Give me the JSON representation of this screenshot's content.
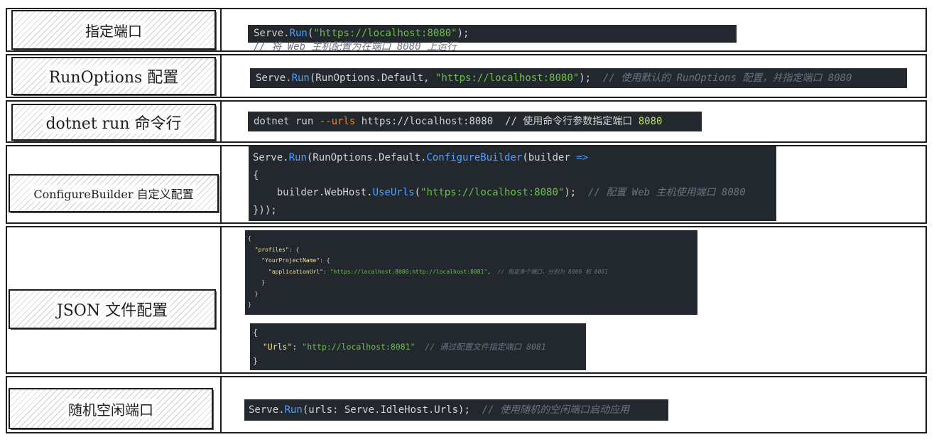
{
  "rows": [
    {
      "label": "指定端口",
      "code": [
        [
          [
            "Serve.",
            "plain"
          ],
          [
            "Run",
            "run"
          ],
          [
            "(",
            "plain"
          ],
          [
            "\"https://localhost:8080\"",
            "str"
          ],
          ");  ",
          "plain"
        ],
        [
          "// 将 Web 主机配置为在端口 8080 上运行",
          "cmt"
        ]
      ]
    },
    {
      "label": "RunOptions 配置",
      "code": [
        [
          [
            "Serve.",
            "plain"
          ],
          [
            "Run",
            "run"
          ],
          [
            "(RunOptions.Default, ",
            "plain"
          ],
          [
            "\"https://localhost:8080\"",
            "str"
          ],
          [
            ");  ",
            "plain"
          ],
          [
            "// 使用默认的 RunOptions 配置，并指定端口 8080",
            "cmt"
          ]
        ]
      ]
    },
    {
      "label": "dotnet run 命令行",
      "code": [
        [
          [
            "dotnet run ",
            "plain"
          ],
          [
            "--urls",
            "opt"
          ],
          [
            " https://localhost:8080  ",
            "plain"
          ],
          [
            "// 使用命令行参数指定端口 ",
            "plaincmt"
          ],
          [
            "8080",
            "num"
          ]
        ]
      ]
    },
    {
      "label": "ConfigureBuilder 自定义配置",
      "code": [
        [
          [
            "Serve.",
            "plain"
          ],
          [
            "Run",
            "run"
          ],
          [
            "(RunOptions.Default.",
            "plain"
          ],
          [
            "ConfigureBuilder",
            "run"
          ],
          [
            "(builder ",
            "plain"
          ],
          [
            "=>",
            "arrow"
          ]
        ],
        [
          [
            "{",
            "plain"
          ]
        ],
        [
          [
            "    builder.WebHost.",
            "plain"
          ],
          [
            "UseUrls",
            "run"
          ],
          [
            "(",
            "plain"
          ],
          [
            "\"https://localhost:8080\"",
            "str"
          ],
          [
            ");  ",
            "plain"
          ],
          [
            "// 配置 Web 主机使用端口 8080",
            "cmt"
          ]
        ],
        [
          [
            "}));",
            "plain"
          ]
        ]
      ]
    },
    {
      "label": "JSON 文件配置",
      "code": [
        [
          [
            "{",
            "plain"
          ]
        ],
        [
          [
            "  ",
            "plain"
          ],
          [
            "\"profiles\"",
            "key"
          ],
          [
            ": {",
            "plain"
          ]
        ],
        [
          [
            "    ",
            "plain"
          ],
          [
            "\"YourProjectName\"",
            "key"
          ],
          [
            ": {",
            "plain"
          ]
        ],
        [
          [
            "      ",
            "plain"
          ],
          [
            "\"applicationUrl\"",
            "key"
          ],
          [
            ": ",
            "plain"
          ],
          [
            "\"https://localhost:8080;http://localhost:8081\"",
            "str"
          ],
          [
            ",  ",
            "plain"
          ],
          [
            "// 指定多个端口，分别为 8080 和 8081",
            "cmt"
          ]
        ],
        [
          [
            "    }",
            "plain"
          ]
        ],
        [
          [
            "  }",
            "plain"
          ]
        ],
        [
          [
            "}",
            "plain"
          ]
        ]
      ],
      "code2": [
        [
          [
            "{",
            "plain"
          ]
        ],
        [
          [
            "  ",
            "plain"
          ],
          [
            "\"Urls\"",
            "key"
          ],
          [
            ": ",
            "plain"
          ],
          [
            "\"http://localhost:8081\"",
            "str"
          ],
          [
            "  ",
            "plain"
          ],
          [
            "// 通过配置文件指定端口 8081",
            "cmt"
          ]
        ],
        [
          [
            "}",
            "plain"
          ]
        ]
      ]
    },
    {
      "label": "随机空闲端口",
      "code": [
        [
          [
            "Serve.",
            "plain"
          ],
          [
            "Run",
            "run"
          ],
          [
            "(urls: Serve.IdleHost.Urls);  ",
            "plain"
          ],
          [
            "// 使用随机的空闲端口启动应用",
            "cmt"
          ]
        ]
      ]
    }
  ],
  "colors": {
    "code_bg": "#23272e",
    "string": "#6cc04a",
    "method": "#4ea1ff",
    "comment": "#6b7280",
    "key": "#f0e2a0",
    "option": "#e88a2e"
  }
}
